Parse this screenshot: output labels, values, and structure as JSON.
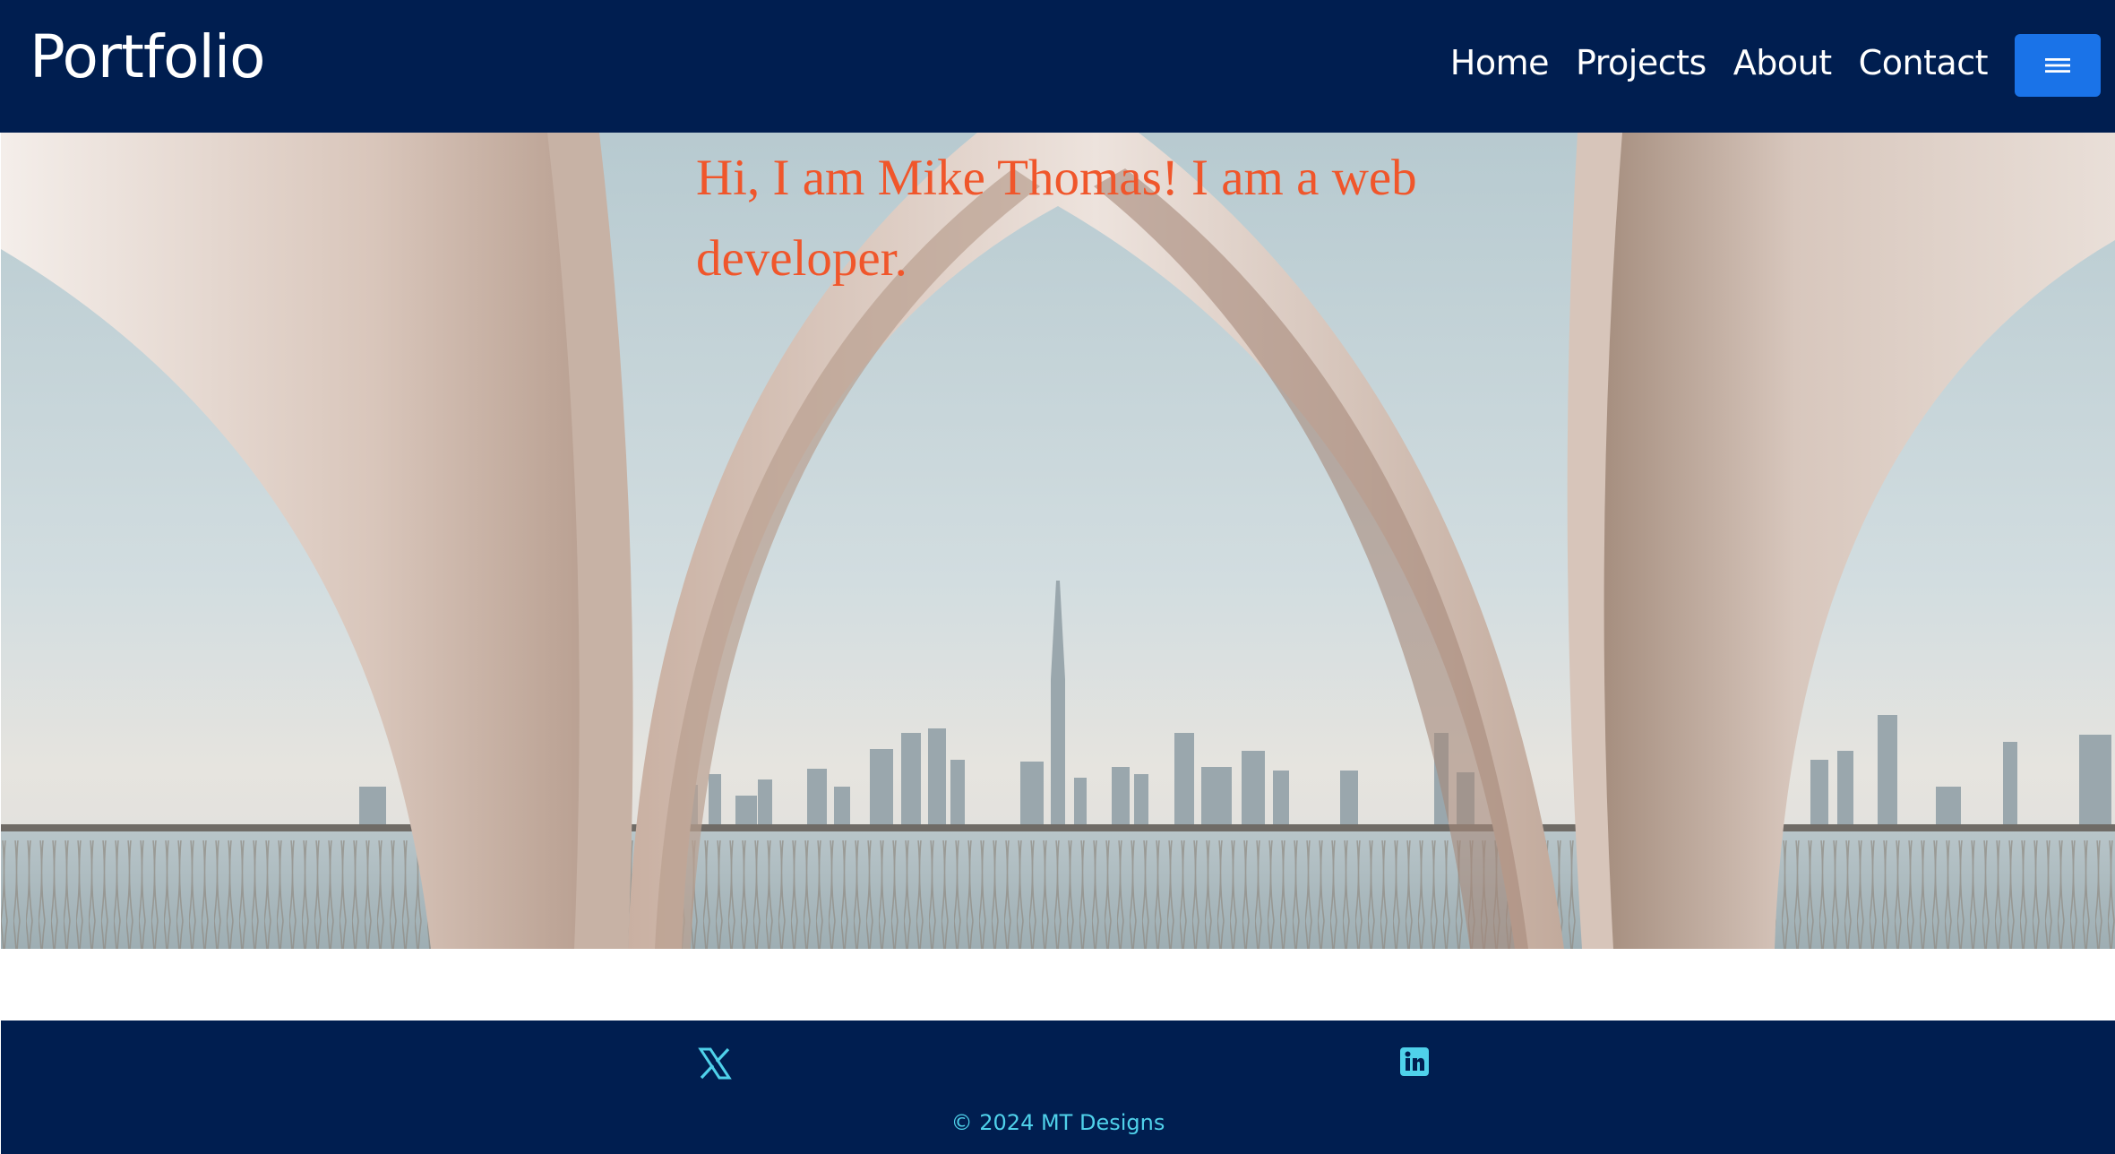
{
  "navbar": {
    "brand": "Portfolio",
    "links": [
      "Home",
      "Projects",
      "About",
      "Contact"
    ],
    "menu_icon": "hamburger-icon"
  },
  "hero": {
    "headline": "Hi, I am Mike Thomas! I am a web developer."
  },
  "footer": {
    "social_icons": [
      "x-twitter-icon",
      "linkedin-icon"
    ],
    "copyright": "© 2024 MT Designs"
  },
  "colors": {
    "navbar_bg": "#001e50",
    "accent_button": "#1a73e8",
    "headline": "#f0562b",
    "footer_text": "#4fd1ea"
  }
}
